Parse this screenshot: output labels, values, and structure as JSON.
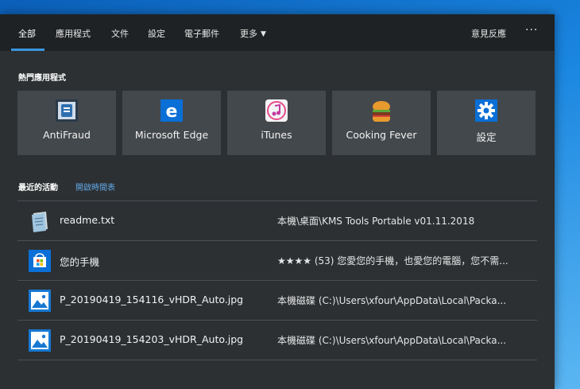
{
  "tabs": [
    {
      "label": "全部"
    },
    {
      "label": "應用程式"
    },
    {
      "label": "文件"
    },
    {
      "label": "設定"
    },
    {
      "label": "電子郵件"
    },
    {
      "label": "更多"
    }
  ],
  "tab_more_chevron": "▼",
  "feedback_label": "意見反應",
  "more_options": "···",
  "top_apps": {
    "title": "熱門應用程式",
    "items": [
      {
        "label": "AntiFraud",
        "icon": "antifraud-icon"
      },
      {
        "label": "Microsoft Edge",
        "icon": "edge-icon"
      },
      {
        "label": "iTunes",
        "icon": "itunes-icon"
      },
      {
        "label": "Cooking Fever",
        "icon": "cooking-fever-icon"
      },
      {
        "label": "設定",
        "icon": "settings-gear-icon"
      }
    ]
  },
  "recent": {
    "title": "最近的活動",
    "timeline_link": "開啟時間表",
    "items": [
      {
        "name": "readme.txt",
        "path": "本機\\桌面\\KMS Tools Portable v01.11.2018",
        "icon": "text-file-icon"
      },
      {
        "name": "您的手機",
        "path": "★★★★ (53) 您愛您的手機，也愛您的電腦，您不需...",
        "icon": "store-icon"
      },
      {
        "name": "P_20190419_154116_vHDR_Auto.jpg",
        "path": "本機磁碟 (C:)\\Users\\xfour\\AppData\\Local\\Packa...",
        "icon": "image-file-icon"
      },
      {
        "name": "P_20190419_154203_vHDR_Auto.jpg",
        "path": "本機磁碟 (C:)\\Users\\xfour\\AppData\\Local\\Packa...",
        "icon": "image-file-icon"
      }
    ]
  },
  "colors": {
    "accent": "#3a96dd",
    "panel_bg": "#2c3033",
    "tile_bg": "#43484c",
    "link": "#63a9e8"
  }
}
